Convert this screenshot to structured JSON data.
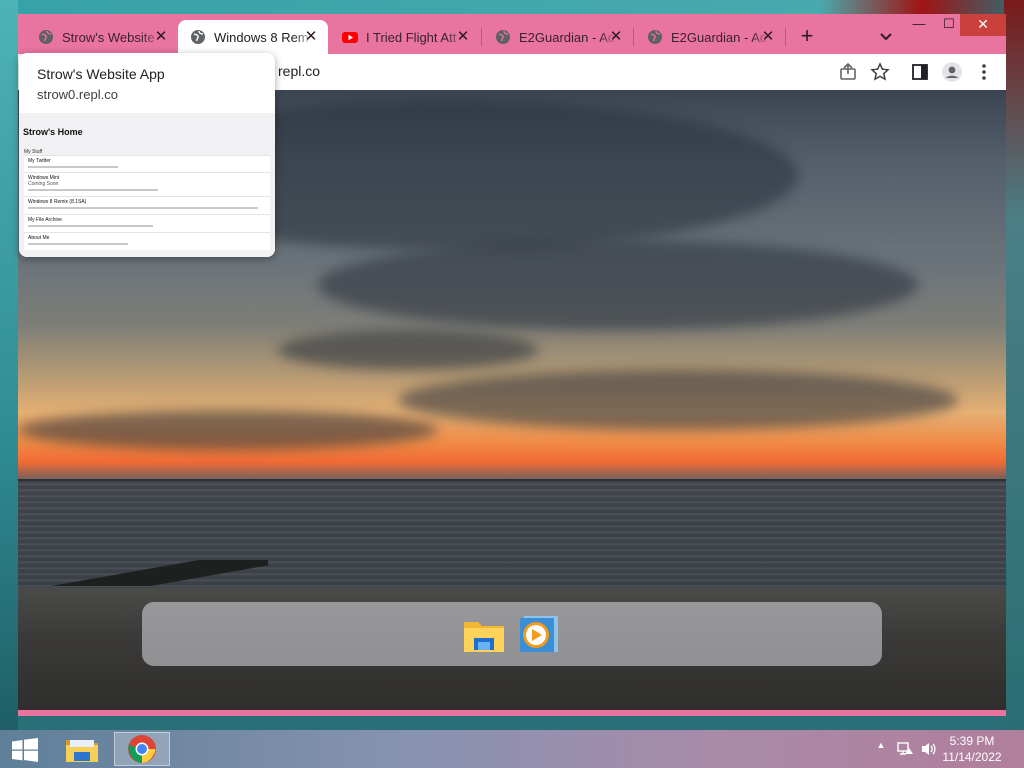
{
  "browser": {
    "tabs": [
      {
        "title": "Strow's Website",
        "favicon": "globe-icon",
        "active": false
      },
      {
        "title": "Windows 8 Rem",
        "favicon": "globe-icon",
        "active": true
      },
      {
        "title": "I Tried Flight Att",
        "favicon": "youtube-icon",
        "active": false
      },
      {
        "title": "E2Guardian - Ac",
        "favicon": "globe-icon",
        "active": false
      },
      {
        "title": "E2Guardian - Ac",
        "favicon": "globe-icon",
        "active": false
      }
    ],
    "new_tab": "+",
    "close_glyph": "✕",
    "omnibox_visible_text": "repl.co",
    "window_controls": {
      "minimize": "—",
      "maximize": "☐",
      "close": "✕"
    }
  },
  "hovercard": {
    "title": "Strow's Website App",
    "url": "strow0.repl.co",
    "preview": {
      "heading": "Strow's Home",
      "section": "My Stuff",
      "items": [
        {
          "title": "My Twitter"
        },
        {
          "title": "Windows Mint",
          "subtitle": "Coming Soon"
        },
        {
          "title": "Windows 8 Remix (8.1SA)"
        },
        {
          "title": "My File Archive"
        },
        {
          "title": "About Me"
        }
      ]
    }
  },
  "dock": {
    "icons": [
      "file-explorer-icon",
      "media-player-icon"
    ]
  },
  "taskbar": {
    "pinned": [
      "file-explorer-icon",
      "chrome-icon"
    ],
    "tray_up": "▲",
    "clock": {
      "time": "5:39 PM",
      "date": "11/14/2022"
    }
  },
  "colors": {
    "frame": "#e8749f",
    "active_tab": "#ffffff",
    "close_button": "#c9403d"
  }
}
